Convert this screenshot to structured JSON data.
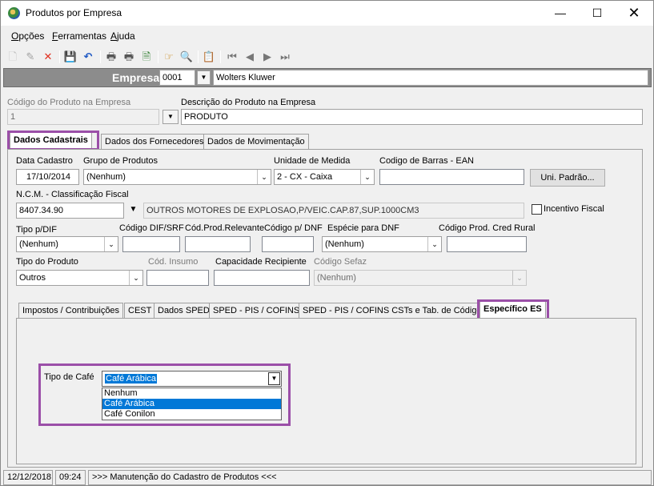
{
  "window": {
    "title": "Produtos por Empresa"
  },
  "menu": [
    {
      "key": "O",
      "rest": "pções"
    },
    {
      "key": "F",
      "rest": "erramentas"
    },
    {
      "key": "A",
      "rest": "juda"
    }
  ],
  "empresa": {
    "label": "Empresa",
    "code": "0001",
    "name": "Wolters Kluwer"
  },
  "produto": {
    "codigo_label": "Código do Produto na Empresa",
    "codigo_value": "1",
    "descricao_label": "Descrição do Produto na Empresa",
    "descricao_value": "PRODUTO"
  },
  "main_tabs": [
    "Dados Cadastrais",
    "Dados dos Fornecedores",
    "Dados de Movimentação"
  ],
  "form": {
    "data_cadastro_label": "Data Cadastro",
    "data_cadastro_value": "17/10/2014",
    "grupo_label": "Grupo de Produtos",
    "grupo_value": "(Nenhum)",
    "unidade_label": "Unidade de Medida",
    "unidade_value": "2 - CX - Caixa",
    "ean_label": "Codigo de Barras - EAN",
    "ean_value": "",
    "uni_padrao_button": "Uni. Padrão...",
    "ncm_label": "N.C.M. -  Classificação Fiscal",
    "ncm_value": "8407.34.90",
    "ncm_desc": "OUTROS MOTORES DE EXPLOSAO,P/VEIC.CAP.87,SUP.1000CM3",
    "incentivo_label": "Incentivo Fiscal",
    "tipo_dif_label": "Tipo p/DIF",
    "tipo_dif_value": "(Nenhum)",
    "cod_dif_label": "Código DIF/SRF",
    "cod_relevante_label": "Cód.Prod.Relevante",
    "cod_dnf_label": "Código p/ DNF",
    "especie_dnf_label": "Espécie para DNF",
    "especie_dnf_value": "(Nenhum)",
    "cred_rural_label": "Código Prod. Cred Rural",
    "tipo_produto_label": "Tipo do Produto",
    "tipo_produto_value": "Outros",
    "cod_insumo_label": "Cód. Insumo",
    "capacidade_label": "Capacidade Recipiente",
    "cod_sefaz_label": "Código Sefaz",
    "cod_sefaz_value": "(Nenhum)"
  },
  "sub_tabs": [
    "Impostos / Contribuições",
    "CEST",
    "Dados SPED",
    "SPED - PIS / COFINS",
    "SPED - PIS / COFINS CSTs e Tab. de Códigos",
    "Específico ES"
  ],
  "especifico": {
    "tipo_cafe_label": "Tipo de Café",
    "tipo_cafe_value": "Café Arábica",
    "options": [
      "Nenhum",
      "Café Arábica",
      "Café Conilon"
    ],
    "selected_index": 1
  },
  "status": {
    "date": "12/12/2018",
    "time": "09:24",
    "message": ">>> Manutenção do Cadastro de Produtos <<<"
  },
  "colors": {
    "highlight": "#9b4fa8",
    "selection": "#0078d7",
    "empresa_bar": "#8c8c8c"
  }
}
